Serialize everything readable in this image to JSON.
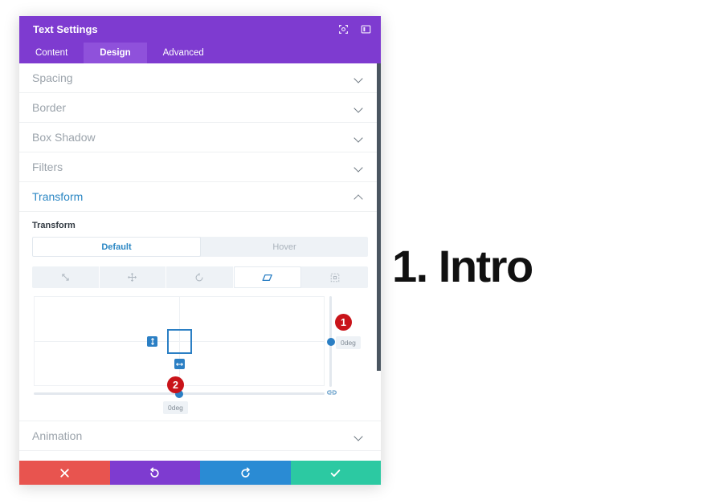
{
  "page": {
    "ghost_heading": "1. Intro",
    "main_heading": "1. Intro"
  },
  "modal": {
    "title": "Text Settings",
    "header_icons": [
      {
        "name": "expand-icon",
        "label": "Expand"
      },
      {
        "name": "layout-icon",
        "label": "Layout"
      }
    ],
    "tabs": [
      {
        "label": "Content",
        "active": false
      },
      {
        "label": "Design",
        "active": true
      },
      {
        "label": "Advanced",
        "active": false
      }
    ],
    "sections": [
      {
        "label": "Spacing",
        "open": false
      },
      {
        "label": "Border",
        "open": false
      },
      {
        "label": "Box Shadow",
        "open": false
      },
      {
        "label": "Filters",
        "open": false
      },
      {
        "label": "Transform",
        "open": true
      },
      {
        "label": "Animation",
        "open": false
      }
    ],
    "transform": {
      "field_label": "Transform",
      "state_tabs": [
        {
          "label": "Default",
          "active": true
        },
        {
          "label": "Hover",
          "active": false
        }
      ],
      "mode_icons": [
        {
          "name": "scale-icon",
          "active": false
        },
        {
          "name": "translate-icon",
          "active": false
        },
        {
          "name": "rotate-icon",
          "active": false
        },
        {
          "name": "skew-icon",
          "active": true
        },
        {
          "name": "origin-icon",
          "active": false
        }
      ],
      "skew_y_value": "0deg",
      "skew_x_value": "0deg",
      "link_icon": "link-icon"
    },
    "annotations": [
      {
        "number": "1"
      },
      {
        "number": "2"
      }
    ],
    "footer_buttons": [
      {
        "name": "cancel-button",
        "icon": "close-icon",
        "color": "#e8544f"
      },
      {
        "name": "undo-button",
        "icon": "undo-icon",
        "color": "#7e3bd0"
      },
      {
        "name": "redo-button",
        "icon": "redo-icon",
        "color": "#2a8bd4"
      },
      {
        "name": "save-button",
        "icon": "check-icon",
        "color": "#2cc9a2"
      }
    ]
  }
}
